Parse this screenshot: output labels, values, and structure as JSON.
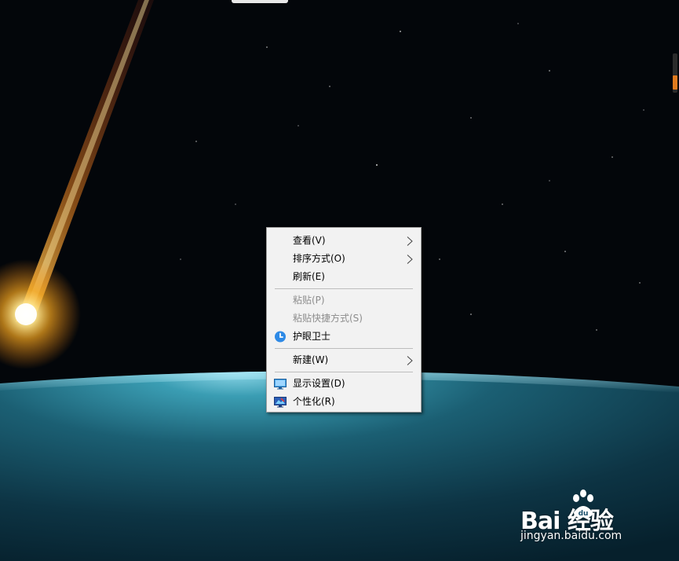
{
  "context_menu": {
    "items": [
      {
        "label": "查看(V)",
        "has_submenu": true,
        "disabled": false
      },
      {
        "label": "排序方式(O)",
        "has_submenu": true,
        "disabled": false
      },
      {
        "label": "刷新(E)",
        "has_submenu": false,
        "disabled": false
      },
      {
        "label": "粘贴(P)",
        "has_submenu": false,
        "disabled": true
      },
      {
        "label": "粘贴快捷方式(S)",
        "has_submenu": false,
        "disabled": true
      },
      {
        "label": "护眼卫士",
        "icon": "eye-guard-icon",
        "has_submenu": false,
        "disabled": false
      },
      {
        "label": "新建(W)",
        "has_submenu": true,
        "disabled": false
      },
      {
        "label": "显示设置(D)",
        "icon": "display-settings-icon",
        "has_submenu": false,
        "disabled": false
      },
      {
        "label": "个性化(R)",
        "icon": "personalize-icon",
        "has_submenu": false,
        "disabled": false
      }
    ]
  },
  "watermark": {
    "brand": "Bai  经验",
    "url": "jingyan.baidu.com"
  },
  "colors": {
    "menu_background": "#f2f2f2",
    "disabled_text": "#8d8d8d",
    "scroll_accent": "#e07a1e"
  }
}
